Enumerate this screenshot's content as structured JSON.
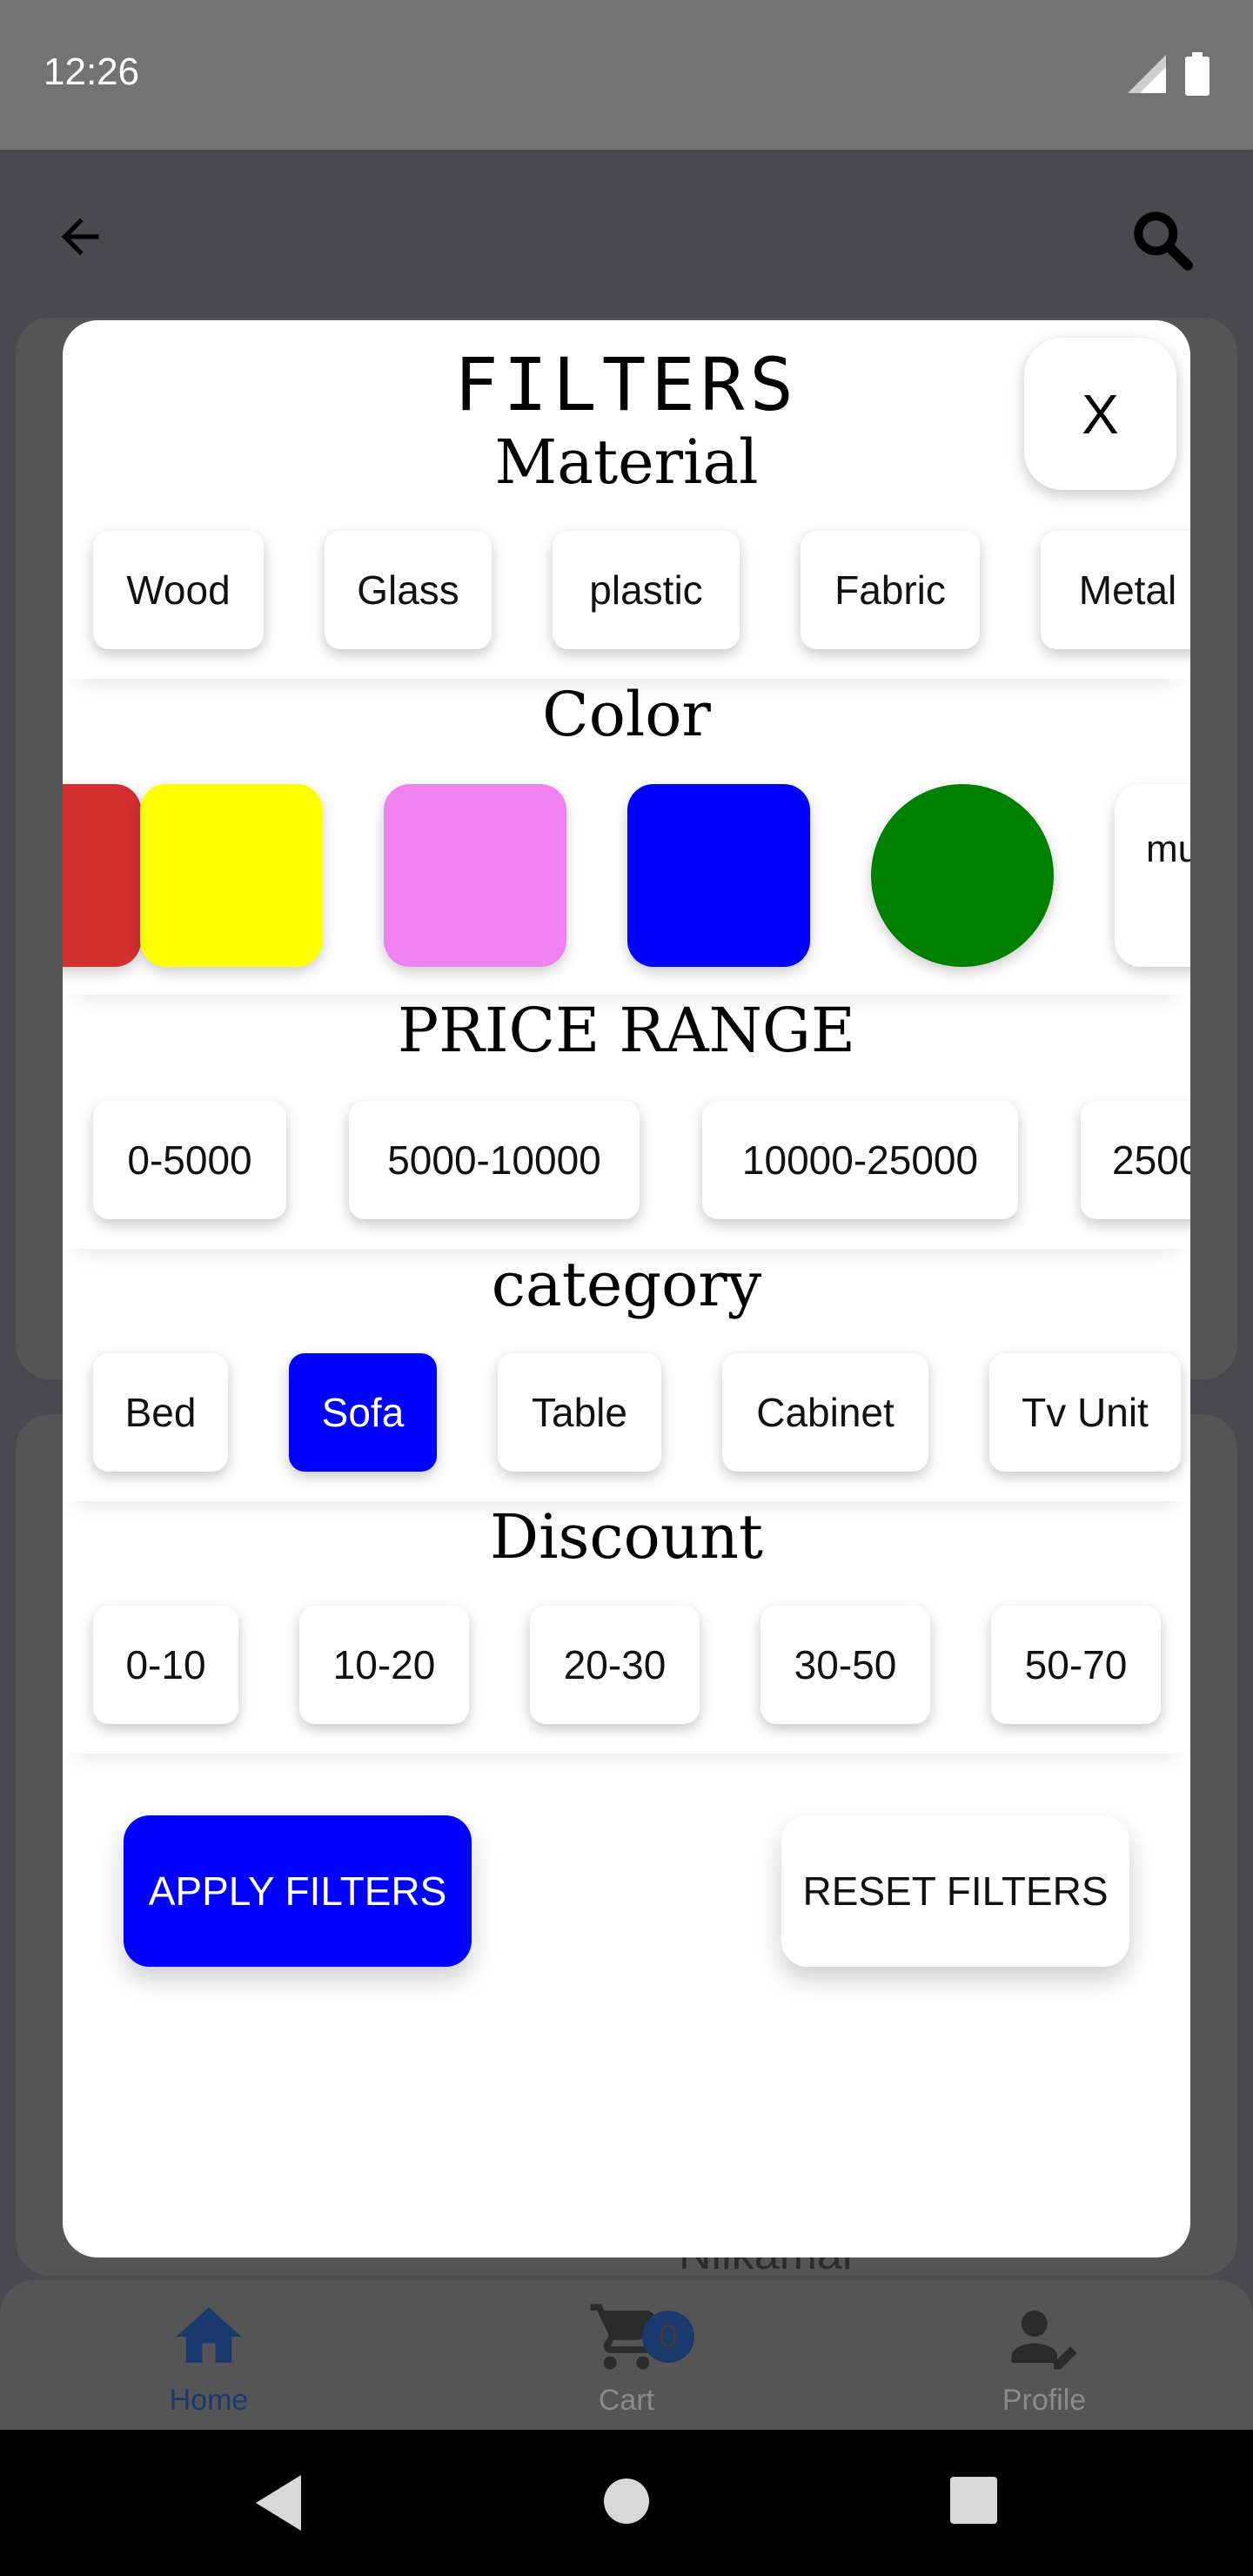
{
  "status_bar": {
    "time": "12:26"
  },
  "modal": {
    "title": "FILTERS",
    "close_label": "X"
  },
  "sections": {
    "material": {
      "title": "Material",
      "options": [
        "Wood",
        "Glass",
        "plastic",
        "Fabric",
        "Metal"
      ]
    },
    "color": {
      "title": "Color",
      "swatches": [
        "#d32f2f",
        "#ffff00",
        "#ee82ee",
        "#0000ff",
        "#008000"
      ],
      "more_label": "mu"
    },
    "price": {
      "title": "PRICE RANGE",
      "options": [
        "0-5000",
        "5000-10000",
        "10000-25000",
        "2500"
      ]
    },
    "category": {
      "title": "category",
      "options": [
        "Bed",
        "Sofa",
        "Table",
        "Cabinet",
        "Tv Unit"
      ],
      "selected": "Sofa"
    },
    "discount": {
      "title": "Discount",
      "options": [
        "0-10",
        "10-20",
        "20-30",
        "30-50",
        "50-70"
      ]
    }
  },
  "actions": {
    "apply_label": "APPLY FILTERS",
    "reset_label": "RESET FILTERS"
  },
  "background": {
    "product_brand": "Nilkamal",
    "cart_count": "0"
  },
  "bottom_nav": {
    "home": "Home",
    "cart": "Cart",
    "profile": "Profile"
  },
  "colors": {
    "accent": "#0000ff",
    "overlay": "#4a4a4e",
    "nav_active": "#1565c0"
  }
}
